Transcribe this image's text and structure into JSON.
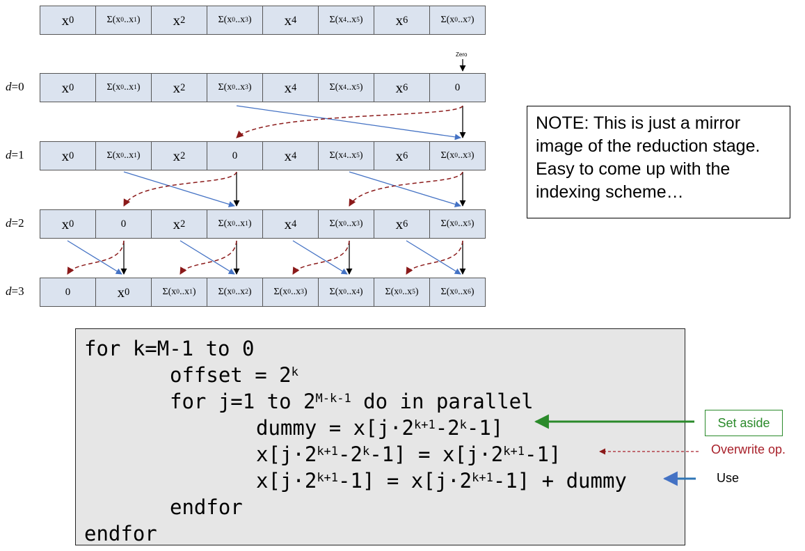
{
  "rows": [
    {
      "label": "",
      "cells": [
        "x0",
        "Σ(x0..x1)",
        "x2",
        "Σ(x0..x3)",
        "x4",
        "Σ(x4..x5)",
        "x6",
        "Σ(x0..x7)"
      ]
    },
    {
      "label": "d=0",
      "cells": [
        "x0",
        "Σ(x0..x1)",
        "x2",
        "Σ(x0..x3)",
        "x4",
        "Σ(x4..x5)",
        "x6",
        "0"
      ]
    },
    {
      "label": "d=1",
      "cells": [
        "x0",
        "Σ(x0..x1)",
        "x2",
        "0",
        "x4",
        "Σ(x4..x5)",
        "x6",
        "Σ(x0..x3)"
      ]
    },
    {
      "label": "d=2",
      "cells": [
        "x0",
        "0",
        "x2",
        "Σ(x0..x1)",
        "x4",
        "Σ(x0..x3)",
        "x6",
        "Σ(x0..x5)"
      ]
    },
    {
      "label": "d=3",
      "cells": [
        "0",
        "x0",
        "Σ(x0..x1)",
        "Σ(x0..x2)",
        "Σ(x0..x3)",
        "Σ(x0..x4)",
        "Σ(x0..x5)",
        "Σ(x0..x6)"
      ]
    }
  ],
  "zero_label": "Zero",
  "note": "NOTE: This is just a mirror image of the reduction stage. Easy to come up with the indexing scheme…",
  "code": {
    "line1": "for k=M-1 to 0",
    "line2": "offset = 2",
    "line2_sup": "k",
    "line3_pre": "for j=1 to 2",
    "line3_sup": "M-k-1",
    "line3_post": " do in parallel",
    "line4": "dummy = x[j·2^{k+1}-2^{k}-1]",
    "line5": "x[j·2^{k+1}-2^{k}-1] = x[j·2^{k+1}-1]",
    "line6": "x[j·2^{k+1}-1] = x[j·2^{k+1}-1] + dummy",
    "line7": "endfor",
    "line8": "endfor"
  },
  "annotations": {
    "set_aside": "Set aside",
    "overwrite": "Overwrite op.",
    "use": "Use"
  },
  "colors": {
    "cell_fill": "#dbe3ef",
    "blue_arrow": "#4472c4",
    "red_arrow": "#8b1a1a",
    "green": "#2a8a2a",
    "code_bg": "#e6e6e6"
  }
}
